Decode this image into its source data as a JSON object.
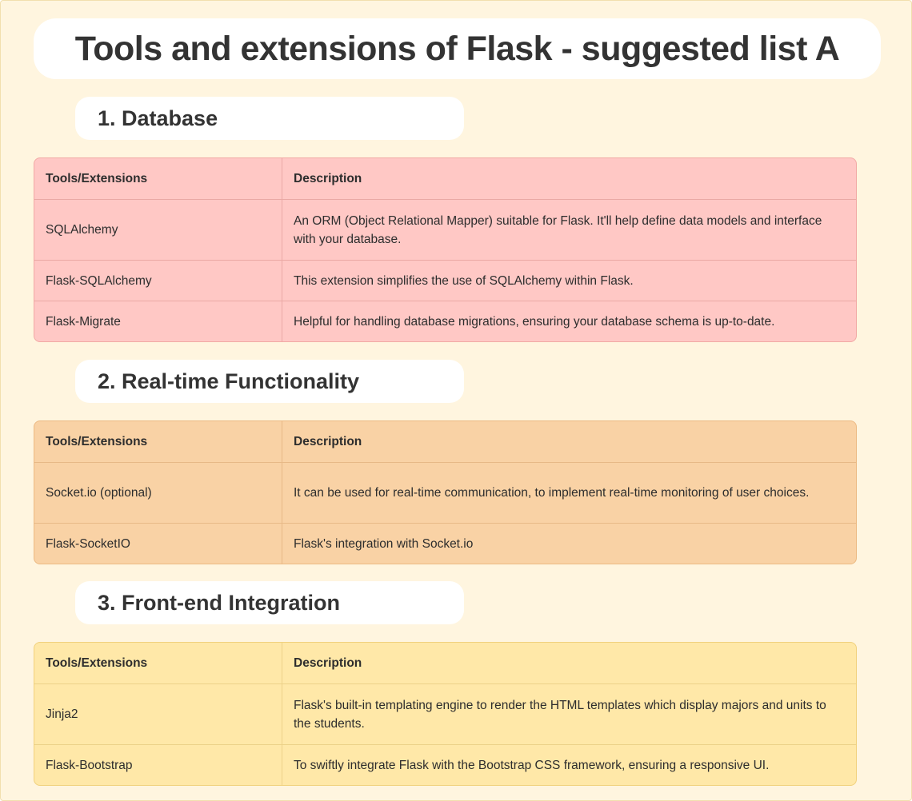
{
  "title": "Tools and extensions of Flask - suggested list A",
  "sections": [
    {
      "heading": "1. Database",
      "columns": [
        "Tools/Extensions",
        "Description"
      ],
      "rows": [
        {
          "tool": "SQLAlchemy",
          "description": "An ORM (Object Relational Mapper) suitable for Flask. It'll help define data models and interface with your database."
        },
        {
          "tool": "Flask-SQLAlchemy",
          "description": "This extension simplifies the use of SQLAlchemy within Flask."
        },
        {
          "tool": "Flask-Migrate",
          "description": "Helpful for handling database migrations, ensuring your database schema is up-to-date."
        }
      ],
      "color": "#ffc8c5"
    },
    {
      "heading": "2. Real-time Functionality",
      "columns": [
        "Tools/Extensions",
        "Description"
      ],
      "rows": [
        {
          "tool": "Socket.io (optional)",
          "description": "It can be used for real-time communication, to implement real-time monitoring of user choices."
        },
        {
          "tool": "Flask-SocketIO",
          "description": "Flask's integration with Socket.io"
        }
      ],
      "color": "#f9d2a5"
    },
    {
      "heading": "3. Front-end Integration",
      "columns": [
        "Tools/Extensions",
        "Description"
      ],
      "rows": [
        {
          "tool": "Jinja2",
          "description": "Flask's built-in templating engine to render the HTML templates which display majors and units to the students."
        },
        {
          "tool": "Flask-Bootstrap",
          "description": "To swiftly integrate Flask with the Bootstrap CSS framework, ensuring a responsive UI."
        }
      ],
      "color": "#ffe8a8"
    }
  ]
}
